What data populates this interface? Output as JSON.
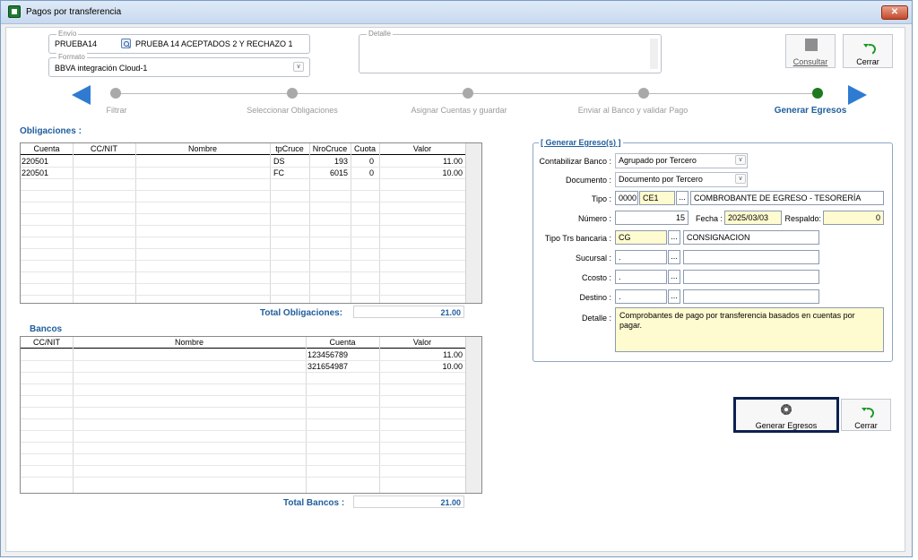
{
  "window": {
    "title": "Pagos por transferencia",
    "close_glyph": "✕"
  },
  "header": {
    "envio": {
      "legend": "Envío",
      "code": "PRUEBA14",
      "description": "PRUEBA 14 ACEPTADOS 2 Y RECHAZO 1"
    },
    "formato": {
      "legend": "Formato",
      "value": "BBVA integración Cloud-1"
    },
    "detalle": {
      "legend": "Detalle",
      "value": ""
    },
    "toolbar": {
      "consultar_label": "Consultar",
      "cerrar_label": "Cerrar"
    }
  },
  "wizard": {
    "steps": [
      {
        "label": "Filtrar",
        "active": false
      },
      {
        "label": "Seleccionar Obligaciones",
        "active": false
      },
      {
        "label": "Asignar Cuentas y guardar",
        "active": false
      },
      {
        "label": "Enviar al Banco y validar Pago",
        "active": false
      },
      {
        "label": "Generar Egresos",
        "active": true
      }
    ]
  },
  "obligaciones": {
    "title": "Obligaciones :",
    "columns": [
      "Cuenta",
      "CC/NIT",
      "Nombre",
      "tpCruce",
      "NroCruce",
      "Cuota",
      "Valor"
    ],
    "rows": [
      {
        "cuenta": "220501",
        "ccnit": "",
        "nombre": "",
        "tpcruce": "DS",
        "nrocruce": "193",
        "cuota": "0",
        "valor": "11.00"
      },
      {
        "cuenta": "220501",
        "ccnit": "",
        "nombre": "",
        "tpcruce": "FC",
        "nrocruce": "6015",
        "cuota": "0",
        "valor": "10.00"
      }
    ],
    "total_label": "Total Obligaciones:",
    "total_value": "21.00"
  },
  "bancos": {
    "title": "Bancos",
    "columns": [
      "CC/NIT",
      "Nombre",
      "Cuenta",
      "Valor"
    ],
    "rows": [
      {
        "ccnit": "",
        "nombre": "",
        "cuenta": "123456789",
        "valor": "11.00"
      },
      {
        "ccnit": "",
        "nombre": "",
        "cuenta": "321654987",
        "valor": "10.00"
      }
    ],
    "total_label": "Total Bancos :",
    "total_value": "21.00"
  },
  "egreso": {
    "title": "[ Generar Egreso(s) ]",
    "contabilizar_label": "Contabilizar Banco :",
    "contabilizar_value": "Agrupado por Tercero",
    "documento_label": "Documento :",
    "documento_value": "Documento por Tercero",
    "tipo_label": "Tipo :",
    "tipo_code": "0000",
    "tipo_sub": "CE1",
    "tipo_desc": "COMBROBANTE DE EGRESO - TESORERÍA",
    "numero_label": "Número :",
    "numero_value": "15",
    "fecha_label": "Fecha :",
    "fecha_value": "2025/03/03",
    "respaldo_label": "Respaldo:",
    "respaldo_value": "0",
    "tipotrs_label": "Tipo Trs bancaria :",
    "tipotrs_code": "CG",
    "tipotrs_desc": "CONSIGNACION",
    "sucursal_label": "Sucursal :",
    "sucursal_value": ".",
    "ccosto_label": "Ccosto :",
    "ccosto_value": ".",
    "destino_label": "Destino :",
    "destino_value": ".",
    "detalle_label": "Detalle :",
    "detalle_value": "Comprobantes de pago por transferencia basados en cuentas por pagar.",
    "ellipsis": "..."
  },
  "actions": {
    "generar_label": "Generar Egresos",
    "cerrar_label": "Cerrar"
  },
  "colors": {
    "accent": "#1f5e9c",
    "highlight_border": "#0d1f4f",
    "wizard_active": "#1e7a1e"
  }
}
